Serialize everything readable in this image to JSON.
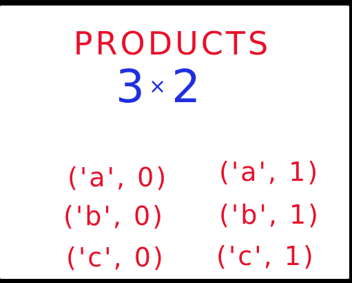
{
  "title": "PRODUCTS",
  "expression": {
    "left": "3",
    "operator": "×",
    "right": "2"
  },
  "pairs": [
    "('a', 0)",
    "('a', 1)",
    "('b', 0)",
    "('b', 1)",
    "('c', 0)",
    "('c', 1)"
  ],
  "colors": {
    "title": "#e8102a",
    "expression": "#1f2fe0",
    "pairs": "#e8102a",
    "background": "#ffffff"
  }
}
